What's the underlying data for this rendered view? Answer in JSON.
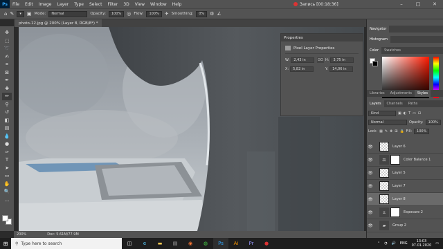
{
  "menubar": {
    "logo": "Ps",
    "items": [
      "File",
      "Edit",
      "Image",
      "Layer",
      "Type",
      "Select",
      "Filter",
      "3D",
      "View",
      "Window",
      "Help"
    ],
    "recording": "Запись [00:18:36]",
    "controls": [
      "–",
      "□",
      "✕"
    ]
  },
  "options": {
    "mode_label": "Mode:",
    "mode_value": "Normal",
    "opacity_label": "Opacity:",
    "opacity_value": "100%",
    "flow_label": "Flow:",
    "flow_value": "100%",
    "smoothing_label": "Smoothing:",
    "smoothing_value": "0%"
  },
  "document": {
    "tab_title": "photo-12.jpg @ 200% (Layer 8, RGB/8*) *",
    "status_zoom": "200%",
    "status_doc": "Doc: 5.61M/77.9M"
  },
  "properties": {
    "title": "Properties",
    "subtitle": "Pixel Layer Properties",
    "w_label": "W:",
    "w_value": "2,43 in",
    "h_label": "H:",
    "h_value": "3,75 in",
    "x_label": "X:",
    "x_value": "5,82 in",
    "y_label": "Y:",
    "y_value": "14,06 in",
    "link": "GO"
  },
  "right": {
    "tabs1": [
      "Navigator"
    ],
    "tabs2": [
      "Histogram"
    ],
    "tabs3": [
      "Color",
      "Swatches"
    ],
    "tabs4": [
      "Libraries",
      "Adjustments",
      "Styles"
    ],
    "tabs5": [
      "Layers",
      "Channels",
      "Paths"
    ],
    "kind": "Kind",
    "blend": "Normal",
    "opacity_label": "Opacity:",
    "opacity_value": "100%",
    "lock_label": "Lock:",
    "fill_label": "Fill:",
    "fill_value": "100%"
  },
  "layers": [
    {
      "name": "Layer 6",
      "type": "pixel"
    },
    {
      "name": "Color Balance 1",
      "type": "adjust"
    },
    {
      "name": "Layer 5",
      "type": "pixel"
    },
    {
      "name": "Layer 7",
      "type": "pixel"
    },
    {
      "name": "Layer 8",
      "type": "pixel"
    },
    {
      "name": "Exposure 2",
      "type": "adjust"
    },
    {
      "name": "Group 2",
      "type": "group"
    }
  ],
  "taskbar": {
    "search_placeholder": "Type here to search",
    "lang": "ENG",
    "time": "13:03",
    "date": "07.01.2020"
  }
}
